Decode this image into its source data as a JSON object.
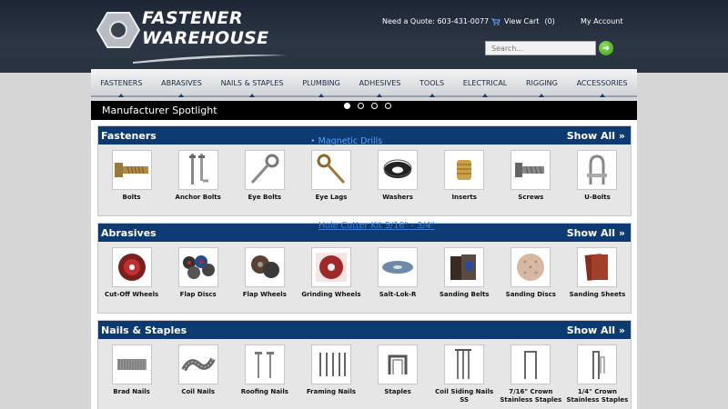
{
  "header": {
    "logo_line1": "FASTENER",
    "logo_line2": "WAREHOUSE",
    "quote_text": "Need a Quote: 603-431-0077",
    "cart_label": "View Cart",
    "cart_count": "(0)",
    "account_label": "My Account",
    "search_placeholder": "Search..."
  },
  "nav": {
    "items": [
      "FASTENERS",
      "ABRASIVES",
      "NAILS & STAPLES",
      "PLUMBING",
      "ADHESIVES",
      "TOOLS",
      "ELECTRICAL",
      "RIGGING",
      "ACCESSORIES"
    ]
  },
  "spotlight": {
    "title": "Manufacturer Spotlight"
  },
  "overlay": {
    "first": "• Magnetic Drills",
    "kit": "Hole Cutter Kit 5/16\" - 3/4\""
  },
  "sections": [
    {
      "title": "Fasteners",
      "show_all": "Show All »",
      "items": [
        "Bolts",
        "Anchor Bolts",
        "Eye Bolts",
        "Eye Lags",
        "Washers",
        "Inserts",
        "Screws",
        "U-Bolts"
      ]
    },
    {
      "title": "Abrasives",
      "show_all": "Show All »",
      "items": [
        "Cut-Off Wheels",
        "Flap Discs",
        "Flap Wheels",
        "Grinding Wheels",
        "Salt-Lok-R",
        "Sanding Belts",
        "Sanding Discs",
        "Sanding Sheets"
      ]
    },
    {
      "title": "Nails & Staples",
      "show_all": "Show All »",
      "items": [
        "Brad Nails",
        "Coil Nails",
        "Roofing Nails",
        "Framing Nails",
        "Staples",
        "Coil Siding Nails SS",
        "7/16\" Crown Stainless Staples",
        "1/4\" Crown Stainless Staples"
      ]
    }
  ],
  "colors": {
    "header_bg": "#2a3340",
    "section_head": "#0d3a70",
    "spotlight_bg": "#000000",
    "go_button": "#4cb52a"
  }
}
